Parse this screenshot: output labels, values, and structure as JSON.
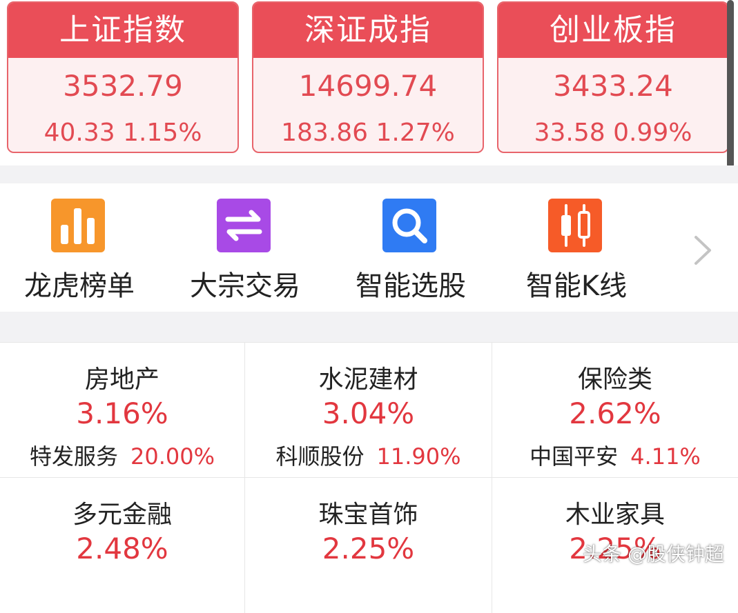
{
  "indices": [
    {
      "name": "上证指数",
      "value": "3532.79",
      "change": "40.33 1.15%"
    },
    {
      "name": "深证成指",
      "value": "14699.74",
      "change": "183.86 1.27%"
    },
    {
      "name": "创业板指",
      "value": "3433.24",
      "change": "33.58 0.99%"
    }
  ],
  "tools": [
    {
      "label": "龙虎榜单",
      "icon": "bar-chart-icon",
      "color": "#f7962b"
    },
    {
      "label": "大宗交易",
      "icon": "exchange-arrows-icon",
      "color": "#a84ae6"
    },
    {
      "label": "智能选股",
      "icon": "search-icon",
      "color": "#2f7bf3"
    },
    {
      "label": "智能K线",
      "icon": "candlestick-icon",
      "color": "#f65b28"
    }
  ],
  "sectors": [
    {
      "name": "房地产",
      "change": "3.16%",
      "leader": "特发服务",
      "leader_change": "20.00%"
    },
    {
      "name": "水泥建材",
      "change": "3.04%",
      "leader": "科顺股份",
      "leader_change": "11.90%"
    },
    {
      "name": "保险类",
      "change": "2.62%",
      "leader": "中国平安",
      "leader_change": "4.11%"
    },
    {
      "name": "多元金融",
      "change": "2.48%",
      "leader": "",
      "leader_change": ""
    },
    {
      "name": "珠宝首饰",
      "change": "2.25%",
      "leader": "",
      "leader_change": ""
    },
    {
      "name": "木业家具",
      "change": "2.25%",
      "leader": "",
      "leader_change": ""
    }
  ],
  "watermark": "头条 @股侠钟超",
  "colors": {
    "index_header": "#ea4e58",
    "index_body": "#fdf0f1",
    "up_red": "#e2373f"
  }
}
